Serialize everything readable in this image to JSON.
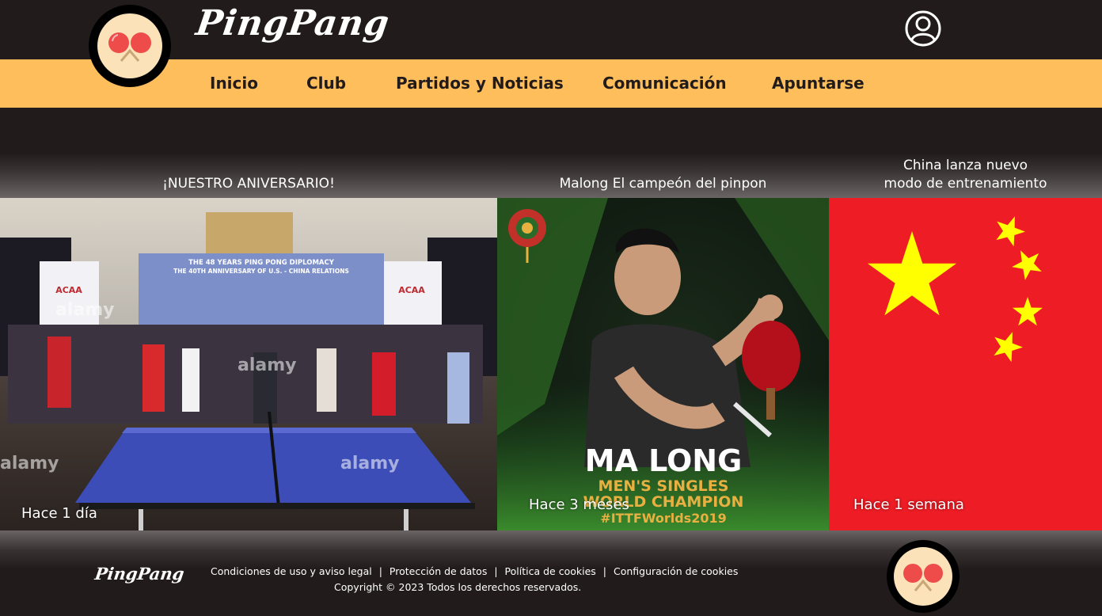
{
  "header": {
    "brand": "PingPang",
    "user_icon": "user-account-icon",
    "logo_icon": "ping-pong-paddles-icon"
  },
  "nav": {
    "items": [
      {
        "label": "Inicio"
      },
      {
        "label": "Club"
      },
      {
        "label": "Partidos y Noticias"
      },
      {
        "label": "Comunicación"
      },
      {
        "label": "Apuntarse"
      }
    ]
  },
  "news": [
    {
      "title": "¡NUESTRO ANIVERSARIO!",
      "time": "Hace 1 día"
    },
    {
      "title": "Malong El campeón del pinpon",
      "time": "Hace 3 meses",
      "overlay": {
        "name": "MA LONG",
        "line1": "MEN'S SINGLES",
        "line2": "WORLD CHAMPION",
        "tag": "#ITTFWorlds2019"
      }
    },
    {
      "title_line1": "China lanza nuevo",
      "title_line2": "modo de entrenamiento",
      "time": "Hace 1 semana"
    }
  ],
  "photo1": {
    "banner_line1": "THE 48 YEARS PING PONG DIPLOMACY",
    "banner_line2": "THE 40TH ANNIVERSARY OF U.S. - CHINA RELATIONS",
    "sign": "ACAA",
    "watermark": "alamy"
  },
  "footer": {
    "brand": "PingPang",
    "links": [
      {
        "label": "Condiciones de uso y aviso legal"
      },
      {
        "label": "Protección de datos"
      },
      {
        "label": "Política de cookies"
      },
      {
        "label": "Configuración de cookies"
      }
    ],
    "separator": "|",
    "copyright": "Copyright © 2023 Todos los derechos reservados."
  },
  "colors": {
    "background": "#221b1b",
    "nav_bar": "#fdbe5b",
    "logo_inner": "#fbe2b8",
    "paddle_red": "#ee4b4b",
    "china_red": "#ee1c25",
    "china_yellow": "#ffff00"
  }
}
